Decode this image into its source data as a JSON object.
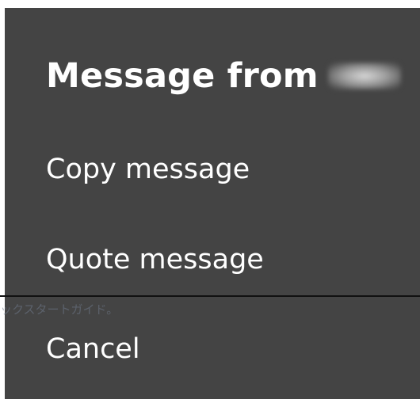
{
  "menu": {
    "title": "Message from",
    "items": [
      {
        "label": "Copy message"
      },
      {
        "label": "Quote message"
      },
      {
        "label": "Cancel"
      }
    ]
  },
  "overlay": {
    "ghost_text": "ックスタートガイド。"
  },
  "colors": {
    "menu_background": "#444444",
    "text": "#ffffff",
    "page_background": "#ffffff",
    "divider": "#111111"
  }
}
